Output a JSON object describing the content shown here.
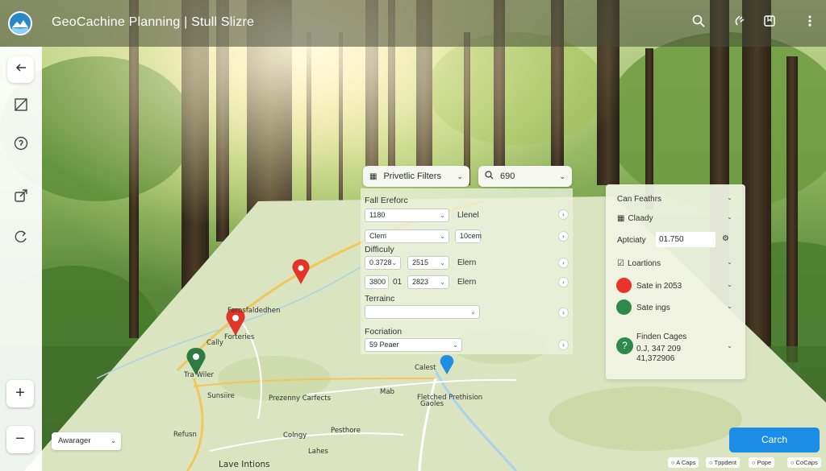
{
  "app": {
    "title": "GeoCachine Planning | Stull Slizre"
  },
  "header": {
    "icons": [
      "search-icon",
      "hand-icon",
      "bookmark-icon",
      "menu-icon"
    ]
  },
  "rail": {
    "items": [
      "back-arrow-icon",
      "crop-icon",
      "help-icon",
      "share-icon",
      "refresh-icon"
    ]
  },
  "filters": {
    "main_label": "Privetlic Filters",
    "search_value": "690",
    "section_1": "Fall Ereforc",
    "row1_value": "1180",
    "row1_label": "Llenel",
    "row2_value": "Clem",
    "row2_label": "10cem",
    "difficulty_label": "Difficuly",
    "diff1_a": "0.3728",
    "diff1_b": "2515",
    "diff1_label": "Elern",
    "diff2_a": "3800",
    "diff2_mid": "01",
    "diff2_b": "2823",
    "diff2_label": "Elern",
    "terrain_label": "Terrainc",
    "terrain_value": "",
    "location_label": "Focriation",
    "location_value": "59 Peaer"
  },
  "right_panel": {
    "title": "Can Feathrs",
    "cloudy": "Claady",
    "aptcity_label": "Aptciaty",
    "aptcity_value": "01.750",
    "locations": "Loartions",
    "loc1": "Sate in 2053",
    "loc2": "Sate ings",
    "finden_title": "Finden Cages",
    "finden_line1": "0.J, 347 209",
    "finden_line2": "41,372906",
    "colors": {
      "loc1": "#e8342b",
      "loc2": "#2f8a4a",
      "finden": "#2f8a4a"
    }
  },
  "map": {
    "labels": {
      "fernlake": "Fernsfaldedhen",
      "cally": "Cally",
      "forteries": "Forteries",
      "trailwiler": "Tra Wiler",
      "sunshire": "Sunsiire",
      "crossing": "Prezenny Carfects",
      "mab": "Mab",
      "calest": "Calest",
      "fetched": "Fletched Prethision",
      "gaoles": "Gaoles",
      "refusn": "Refusn",
      "colngy": "Colngy",
      "peshore": "Pesthore",
      "lakes": "Lahes",
      "lave": "Lave Intions"
    }
  },
  "controls": {
    "zoom_in": "+",
    "zoom_out": "−",
    "layer_select": "Awarager",
    "search_button": "Carch",
    "attrib": [
      "A Caps",
      "Tppdent",
      "Pope",
      "CoCaps"
    ]
  }
}
